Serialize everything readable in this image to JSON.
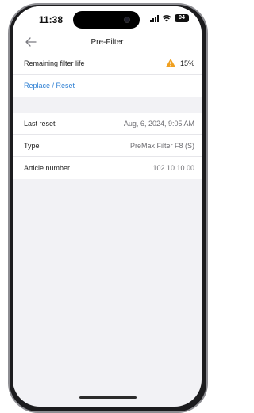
{
  "status_bar": {
    "time": "11:38",
    "battery": "94"
  },
  "nav": {
    "title": "Pre-Filter"
  },
  "filter": {
    "remaining_label": "Remaining filter life",
    "remaining_value": "15%",
    "warning_color": "#f0a020",
    "replace_label": "Replace / Reset",
    "link_color": "#2d7fd3"
  },
  "details": {
    "last_reset_label": "Last reset",
    "last_reset_value": "Aug, 6, 2024, 9:05 AM",
    "type_label": "Type",
    "type_value": "PreMax Filter F8 (S)",
    "article_label": "Article number",
    "article_value": "102.10.10.00"
  }
}
